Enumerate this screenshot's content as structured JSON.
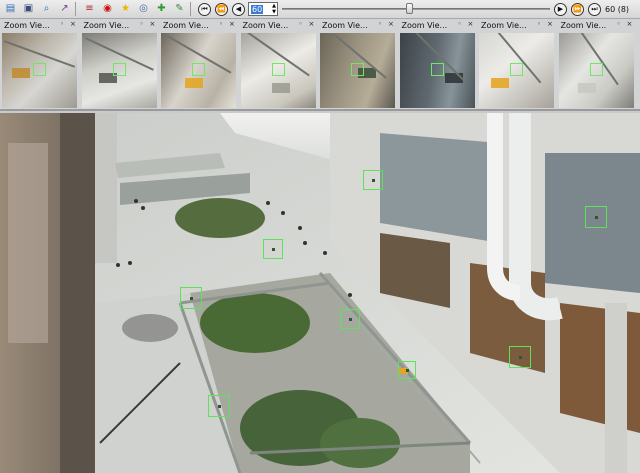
{
  "toolbar": {
    "icons": [
      {
        "name": "save-icon",
        "glyph": "▤",
        "color": "#2f6db5"
      },
      {
        "name": "camera-icon",
        "glyph": "▣",
        "color": "#3a4a7a"
      },
      {
        "name": "zoom-icon",
        "glyph": "⌕",
        "color": "#2e6fb2"
      },
      {
        "name": "chart-icon",
        "glyph": "↗",
        "color": "#7a3a9a"
      },
      {
        "name": "track-list-icon",
        "glyph": "≡",
        "color": "#b52222"
      },
      {
        "name": "record-icon",
        "glyph": "◉",
        "color": "#cc1111"
      },
      {
        "name": "star-icon",
        "glyph": "★",
        "color": "#e7b800"
      },
      {
        "name": "target-icon",
        "glyph": "◎",
        "color": "#4a6ea0"
      },
      {
        "name": "add-icon",
        "glyph": "✚",
        "color": "#2f9a2f"
      },
      {
        "name": "edit-track-icon",
        "glyph": "✎",
        "color": "#3a8a3a"
      }
    ],
    "frame_input_value": "60",
    "slider_position_fraction": 0.475,
    "frame_label": "60 (8)",
    "nav_left": [
      "⏮",
      "⏪",
      "◀"
    ],
    "nav_right": [
      "▶",
      "⏩",
      "⏭"
    ]
  },
  "zoom_panels": [
    {
      "title": "Zoom Vie...",
      "bg": "linear-gradient(135deg,#8a7d68 0%,#bcb6ab 35%,#d7d6d2 60%,#9e9a92 100%)",
      "accent": "#c08a2a"
    },
    {
      "title": "Zoom Vie...",
      "bg": "linear-gradient(160deg,#7c7a74 0%,#cfcfc9 40%,#e6e6e3 70%,#a9a9a2 100%)",
      "accent": "#50544f"
    },
    {
      "title": "Zoom Vie...",
      "bg": "linear-gradient(120deg,#6b645a 0%,#d8d4cb 45%,#b8b2a6 75%,#e6e2d8 100%)",
      "accent": "#e4a51c"
    },
    {
      "title": "Zoom Vie...",
      "bg": "linear-gradient(150deg,#a7a49c 0%,#ecebe6 45%,#c9c6bd 80%,#8c887f 100%)",
      "accent": "#9a9a90"
    },
    {
      "title": "Zoom Vie...",
      "bg": "linear-gradient(110deg,#6a6558 0%,#9a9280 40%,#b6ad98 70%,#5c5850 100%)",
      "accent": "#3b4d3a"
    },
    {
      "title": "Zoom Vie...",
      "bg": "linear-gradient(100deg,#3d4348 0%,#5f6a70 45%,#87949a 70%,#4a5358 100%)",
      "accent": "#2b3236"
    },
    {
      "title": "Zoom Vie...",
      "bg": "linear-gradient(140deg,#d6d6d3 0%,#ecebe8 40%,#c5c2bb 75%,#a5a19a 100%)",
      "accent": "#e6a21e"
    },
    {
      "title": "Zoom Vie...",
      "bg": "linear-gradient(130deg,#9b9a95 0%,#e5e5e2 40%,#cacac5 70%,#7e7d78 100%)",
      "accent": "#c8c8c2"
    }
  ],
  "colors": {
    "track_box": "#5de25a",
    "floor": "#d5d7d2",
    "railing": "#8f9590",
    "trees": "#4a6a35",
    "storefront": "#7e5a3a",
    "ceiling": "#e8e9e7"
  }
}
